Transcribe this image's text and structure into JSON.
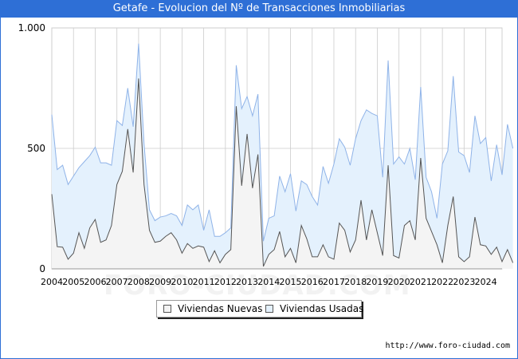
{
  "title": "Getafe - Evolucion del Nº de Transacciones Inmobiliarias",
  "credit": "http://www.foro-ciudad.com",
  "watermark": "FORO-CIUDAD.COM",
  "colors": {
    "header": "#2e6fd6",
    "nuevas_fill": "#f4f4f4",
    "nuevas_line": "#555555",
    "usadas_fill": "#e4f1fd",
    "usadas_line": "#8fb3e8",
    "grid": "#cccccc"
  },
  "chart_data": {
    "type": "area",
    "title": "Getafe - Evolucion del Nº de Transacciones Inmobiliarias",
    "xlabel": "",
    "ylabel": "",
    "ylim": [
      0,
      1000
    ],
    "yticks": [
      0,
      500,
      1000
    ],
    "ytick_labels": [
      "0",
      "500",
      "1.000"
    ],
    "x_year_labels": [
      "2004",
      "2005",
      "2006",
      "2007",
      "2008",
      "2009",
      "2010",
      "2011",
      "2012",
      "2013",
      "2014",
      "2015",
      "2016",
      "2017",
      "2018",
      "2019",
      "2020",
      "2021",
      "2022",
      "2023",
      "2024"
    ],
    "x_start": 2004,
    "x_end": 2024.75,
    "x_step": 0.25,
    "grid": true,
    "legend_position": "bottom",
    "stacked": true,
    "series": [
      {
        "name": "Viviendas Nuevas",
        "values": [
          310,
          92,
          90,
          40,
          65,
          150,
          85,
          170,
          205,
          110,
          120,
          180,
          350,
          405,
          580,
          400,
          790,
          350,
          160,
          110,
          115,
          135,
          150,
          120,
          65,
          105,
          85,
          95,
          90,
          30,
          75,
          25,
          60,
          80,
          675,
          345,
          560,
          335,
          475,
          10,
          60,
          80,
          155,
          50,
          85,
          25,
          180,
          125,
          50,
          50,
          100,
          50,
          40,
          190,
          160,
          70,
          120,
          285,
          120,
          245,
          150,
          55,
          430,
          55,
          45,
          180,
          200,
          120,
          460,
          210,
          155,
          100,
          25,
          180,
          300,
          50,
          30,
          50,
          215,
          100,
          95,
          60,
          90,
          30,
          80,
          25
        ]
      },
      {
        "name": "Viviendas Usadas",
        "values": [
          330,
          320,
          340,
          310,
          320,
          270,
          360,
          300,
          300,
          330,
          320,
          250,
          265,
          190,
          170,
          190,
          145,
          170,
          85,
          90,
          100,
          85,
          80,
          100,
          115,
          160,
          160,
          170,
          70,
          215,
          60,
          110,
          90,
          90,
          170,
          320,
          155,
          300,
          250,
          105,
          150,
          140,
          230,
          270,
          310,
          215,
          185,
          225,
          250,
          215,
          325,
          305,
          395,
          350,
          345,
          360,
          420,
          330,
          540,
          400,
          485,
          325,
          435,
          380,
          420,
          255,
          300,
          250,
          295,
          170,
          165,
          110,
          410,
          310,
          500,
          435,
          440,
          350,
          420,
          420,
          450,
          305,
          425,
          360,
          520,
          475
        ]
      }
    ]
  },
  "legend": {
    "items": [
      {
        "label": "Viviendas Nuevas"
      },
      {
        "label": "Viviendas Usadas"
      }
    ]
  }
}
